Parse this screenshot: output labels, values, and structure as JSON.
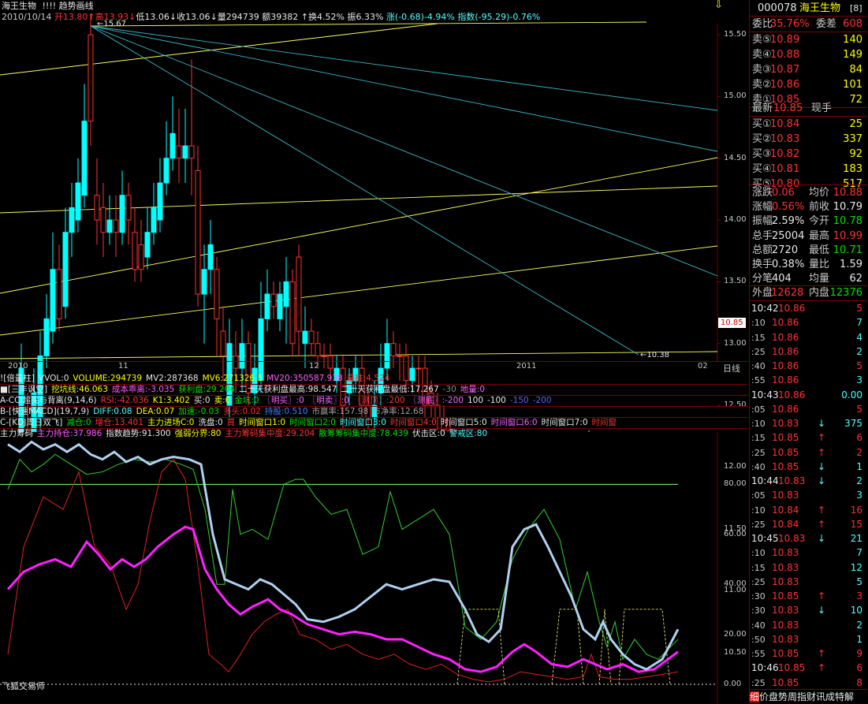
{
  "header": {
    "stock_name": "海王生物",
    "indicator_marks": "!!!!",
    "chart_tool": "趋势画线",
    "date": "2010/10/14",
    "open_label": "开",
    "open": "13.80",
    "high_label": "高",
    "high": "13.93",
    "low_label": "低",
    "low": "13.06",
    "close_label": "收",
    "close": "13.06",
    "volume_label": "量",
    "volume": "294739",
    "amount_label": "额",
    "amount": "39382",
    "turnover_label": "换",
    "turnover": "4.52%",
    "amplitude_label": "振",
    "amplitude": "6.33%",
    "change_text": "涨(-0.68)-4.94%",
    "index_text": "指数(-95.29)-0.76%",
    "pin_icon": "⇩"
  },
  "price_axis": [
    "15.50",
    "15.00",
    "14.50",
    "14.00",
    "13.50",
    "13.00",
    "12.50",
    "12.00",
    "11.50",
    "11.00",
    "10.50"
  ],
  "price_annotations": {
    "high_mark": "15.67",
    "low_mark": "10.38",
    "current_tag": "10.85"
  },
  "date_axis": {
    "labels": [
      "2010",
      "11",
      "12",
      "2011",
      "02"
    ],
    "period_button": "日线"
  },
  "indicator_lines": {
    "vol": {
      "prefix": "![倍量柱]",
      "vvol": "VVOL:0",
      "volume": "VOLUME:294739",
      "mv2": "MV2:287368",
      "mv6": "MV6:271326.5",
      "mv20": "MV20:350587.938",
      "liang": "量柱:4.524"
    },
    "sanfeng": {
      "prefix": "■[三丰讽空]",
      "wakeng": "挖坑线:46.063",
      "cost": "成本乖离:-3.035",
      "profit": "获利盘:29.204",
      "max20": "二十天获利盘最高:98.547",
      "min20": "二十天获利盘最低:17.267",
      "neg": "-30",
      "dizhi": "地量:0"
    },
    "cci": {
      "prefix": "A-CCI超买与背离(9,14,6)",
      "rsi": "RSI:-42.036",
      "k1": "K1:3.402",
      "buy": "买:0",
      "sell": "卖:0",
      "jinzhu": "金坑:0",
      "mingmai": "〖明买〗:0",
      "mingmai2": "〖明卖〗:0",
      "ceding": "〖测顶〗:200",
      "cedi": "〖测底〗:-200",
      "l100": "100",
      "lm100": "-100",
      "lm150": "-150",
      "lm200": "-200"
    },
    "macd": {
      "prefix": "B-[快速MACD](19,7,9)",
      "diff": "DIFF:0.08",
      "dea": "DEA:0.07",
      "jiasu": "加速:-0.03",
      "duotou": "多头:0.02",
      "zhengzhang": "持股:0.510",
      "shiying": "市赢率:157.98",
      "shijing": "市净率:12.68"
    },
    "kdj": {
      "prefix": "C-[KDJ周日双飞]",
      "jiancang": "减仓:0",
      "zengcang": "增仓:13.401",
      "zhuli": "主力进场C:0",
      "xipan": "洗盘:0",
      "mai": "買",
      "w1": "时间窗口1:0",
      "w2": "时间窗口2:0",
      "w3": "时间窗口3:0",
      "w4": "时间窗口4:0",
      "w5": "时间窗口5:0",
      "w6": "时间窗口6:0",
      "w7": "时间窗口7:0",
      "w8": "时间窗"
    },
    "chips": {
      "prefix": "主力筹码",
      "chicang": "主力持仓:37.986",
      "trend": "指数趋势:91.300",
      "qiangruo": "强弱分界:80",
      "jizhong": "主力筹码集中度:29.204",
      "sanhu": "散筹筹码集中度:78.439",
      "fubing": "伏击区:0",
      "jingjie": "警戒区:80"
    }
  },
  "indicator_axis": [
    "80.00",
    "60.00",
    "40.00",
    "20.00",
    "0.00"
  ],
  "footer_brand": "飞狐交易师",
  "quote_panel": {
    "code": "000078",
    "name": "海王生物",
    "badge": "[8]",
    "weibi_label": "委比",
    "weibi": "35.76%",
    "weicha_label": "委差",
    "weicha": "608",
    "asks": [
      {
        "label": "卖⑤",
        "price": "10.89",
        "vol": "140"
      },
      {
        "label": "卖④",
        "price": "10.88",
        "vol": "149"
      },
      {
        "label": "卖③",
        "price": "10.87",
        "vol": "84"
      },
      {
        "label": "卖②",
        "price": "10.86",
        "vol": "101"
      },
      {
        "label": "卖①",
        "price": "10.85",
        "vol": "72"
      }
    ],
    "last_label": "最新",
    "last": "10.85",
    "last_flag": "现手",
    "bids": [
      {
        "label": "买①",
        "price": "10.84",
        "vol": "25"
      },
      {
        "label": "买②",
        "price": "10.83",
        "vol": "337"
      },
      {
        "label": "买③",
        "price": "10.82",
        "vol": "92"
      },
      {
        "label": "买④",
        "price": "10.81",
        "vol": "183"
      },
      {
        "label": "买⑤",
        "price": "10.80",
        "vol": "517"
      }
    ],
    "stats": [
      {
        "l1": "涨跌",
        "v1": "0.06",
        "c1": "red",
        "l2": "均价",
        "v2": "10.88",
        "c2": "red"
      },
      {
        "l1": "涨幅",
        "v1": "0.56%",
        "c1": "red",
        "l2": "前收",
        "v2": "10.79",
        "c2": "white"
      },
      {
        "l1": "振幅",
        "v1": "2.59%",
        "c1": "white",
        "l2": "今开",
        "v2": "10.78",
        "c2": "green"
      },
      {
        "l1": "总手",
        "v1": "25004",
        "c1": "white",
        "l2": "最高",
        "v2": "10.99",
        "c2": "red"
      },
      {
        "l1": "总额",
        "v1": "2720",
        "c1": "white",
        "l2": "最低",
        "v2": "10.71",
        "c2": "green"
      },
      {
        "l1": "换手",
        "v1": "0.38%",
        "c1": "white",
        "l2": "量比",
        "v2": "1.59",
        "c2": "white"
      },
      {
        "l1": "分笔",
        "v1": "404",
        "c1": "white",
        "l2": "均量",
        "v2": "62",
        "c2": "white"
      }
    ],
    "outer_label": "外盘",
    "outer": "12628",
    "inner_label": "内盘",
    "inner": "12376",
    "ticks": [
      {
        "time": "10:42",
        "bold": true,
        "price": "10.86",
        "pc": "red",
        "arr": "",
        "ac": "",
        "vol": "5",
        "vc": "red"
      },
      {
        "time": ":10",
        "bold": false,
        "price": "10.86",
        "pc": "red",
        "arr": "",
        "ac": "",
        "vol": "7",
        "vc": "cyan"
      },
      {
        "time": ":15",
        "bold": false,
        "price": "10.86",
        "pc": "red",
        "arr": "",
        "ac": "",
        "vol": "4",
        "vc": "cyan"
      },
      {
        "time": ":25",
        "bold": false,
        "price": "10.86",
        "pc": "red",
        "arr": "",
        "ac": "",
        "vol": "2",
        "vc": "cyan"
      },
      {
        "time": ":40",
        "bold": false,
        "price": "10.86",
        "pc": "red",
        "arr": "",
        "ac": "",
        "vol": "5",
        "vc": "red"
      },
      {
        "time": ":55",
        "bold": false,
        "price": "10.86",
        "pc": "red",
        "arr": "",
        "ac": "",
        "vol": "3",
        "vc": "cyan"
      },
      {
        "time": "10:43",
        "bold": true,
        "price": "10.86",
        "pc": "red",
        "arr": "",
        "ac": "",
        "vol": "0.00",
        "vc": "cyan"
      },
      {
        "time": ":05",
        "bold": false,
        "price": "10.86",
        "pc": "red",
        "arr": "",
        "ac": "",
        "vol": "5",
        "vc": "red"
      },
      {
        "time": ":10",
        "bold": false,
        "price": "10.83",
        "pc": "red",
        "arr": "↓",
        "ac": "cyan",
        "vol": "375",
        "vc": "cyan"
      },
      {
        "time": ":15",
        "bold": false,
        "price": "10.85",
        "pc": "red",
        "arr": "↑",
        "ac": "red",
        "vol": "6",
        "vc": "red"
      },
      {
        "time": ":25",
        "bold": false,
        "price": "10.85",
        "pc": "red",
        "arr": "↑",
        "ac": "red",
        "vol": "2",
        "vc": "red"
      },
      {
        "time": ":40",
        "bold": false,
        "price": "10.85",
        "pc": "red",
        "arr": "↓",
        "ac": "cyan",
        "vol": "1",
        "vc": "cyan"
      },
      {
        "time": "10:44",
        "bold": true,
        "price": "10.83",
        "pc": "red",
        "arr": "↓",
        "ac": "cyan",
        "vol": "2",
        "vc": "cyan"
      },
      {
        "time": ":05",
        "bold": false,
        "price": "10.83",
        "pc": "red",
        "arr": "",
        "ac": "",
        "vol": "3",
        "vc": "cyan"
      },
      {
        "time": ":10",
        "bold": false,
        "price": "10.84",
        "pc": "red",
        "arr": "↑",
        "ac": "red",
        "vol": "16",
        "vc": "red"
      },
      {
        "time": ":25",
        "bold": false,
        "price": "10.84",
        "pc": "red",
        "arr": "↑",
        "ac": "red",
        "vol": "15",
        "vc": "red"
      },
      {
        "time": "10:45",
        "bold": true,
        "price": "10.83",
        "pc": "red",
        "arr": "↓",
        "ac": "cyan",
        "vol": "21",
        "vc": "cyan"
      },
      {
        "time": ":10",
        "bold": false,
        "price": "10.83",
        "pc": "red",
        "arr": "",
        "ac": "",
        "vol": "7",
        "vc": "cyan"
      },
      {
        "time": ":15",
        "bold": false,
        "price": "10.83",
        "pc": "red",
        "arr": "",
        "ac": "",
        "vol": "12",
        "vc": "cyan"
      },
      {
        "time": ":25",
        "bold": false,
        "price": "10.83",
        "pc": "red",
        "arr": "",
        "ac": "",
        "vol": "5",
        "vc": "cyan"
      },
      {
        "time": ":30",
        "bold": false,
        "price": "10.85",
        "pc": "red",
        "arr": "↑",
        "ac": "red",
        "vol": "3",
        "vc": "red"
      },
      {
        "time": ":30",
        "bold": false,
        "price": "10.83",
        "pc": "red",
        "arr": "↓",
        "ac": "cyan",
        "vol": "10",
        "vc": "cyan"
      },
      {
        "time": ":40",
        "bold": false,
        "price": "10.83",
        "pc": "red",
        "arr": "",
        "ac": "",
        "vol": "2",
        "vc": "cyan"
      },
      {
        "time": ":50",
        "bold": false,
        "price": "10.83",
        "pc": "red",
        "arr": "",
        "ac": "",
        "vol": "1",
        "vc": "cyan"
      },
      {
        "time": ":55",
        "bold": false,
        "price": "10.85",
        "pc": "red",
        "arr": "↑",
        "ac": "red",
        "vol": "9",
        "vc": "red"
      },
      {
        "time": "10:46",
        "bold": true,
        "price": "10.85",
        "pc": "red",
        "arr": "↑",
        "ac": "red",
        "vol": "6",
        "vc": "red"
      },
      {
        "time": ":25",
        "bold": false,
        "price": "10.85",
        "pc": "red",
        "arr": "",
        "ac": "",
        "vol": "8",
        "vc": "red"
      }
    ],
    "bottom_tabs": "细价盘势周指财讯成特解"
  }
}
